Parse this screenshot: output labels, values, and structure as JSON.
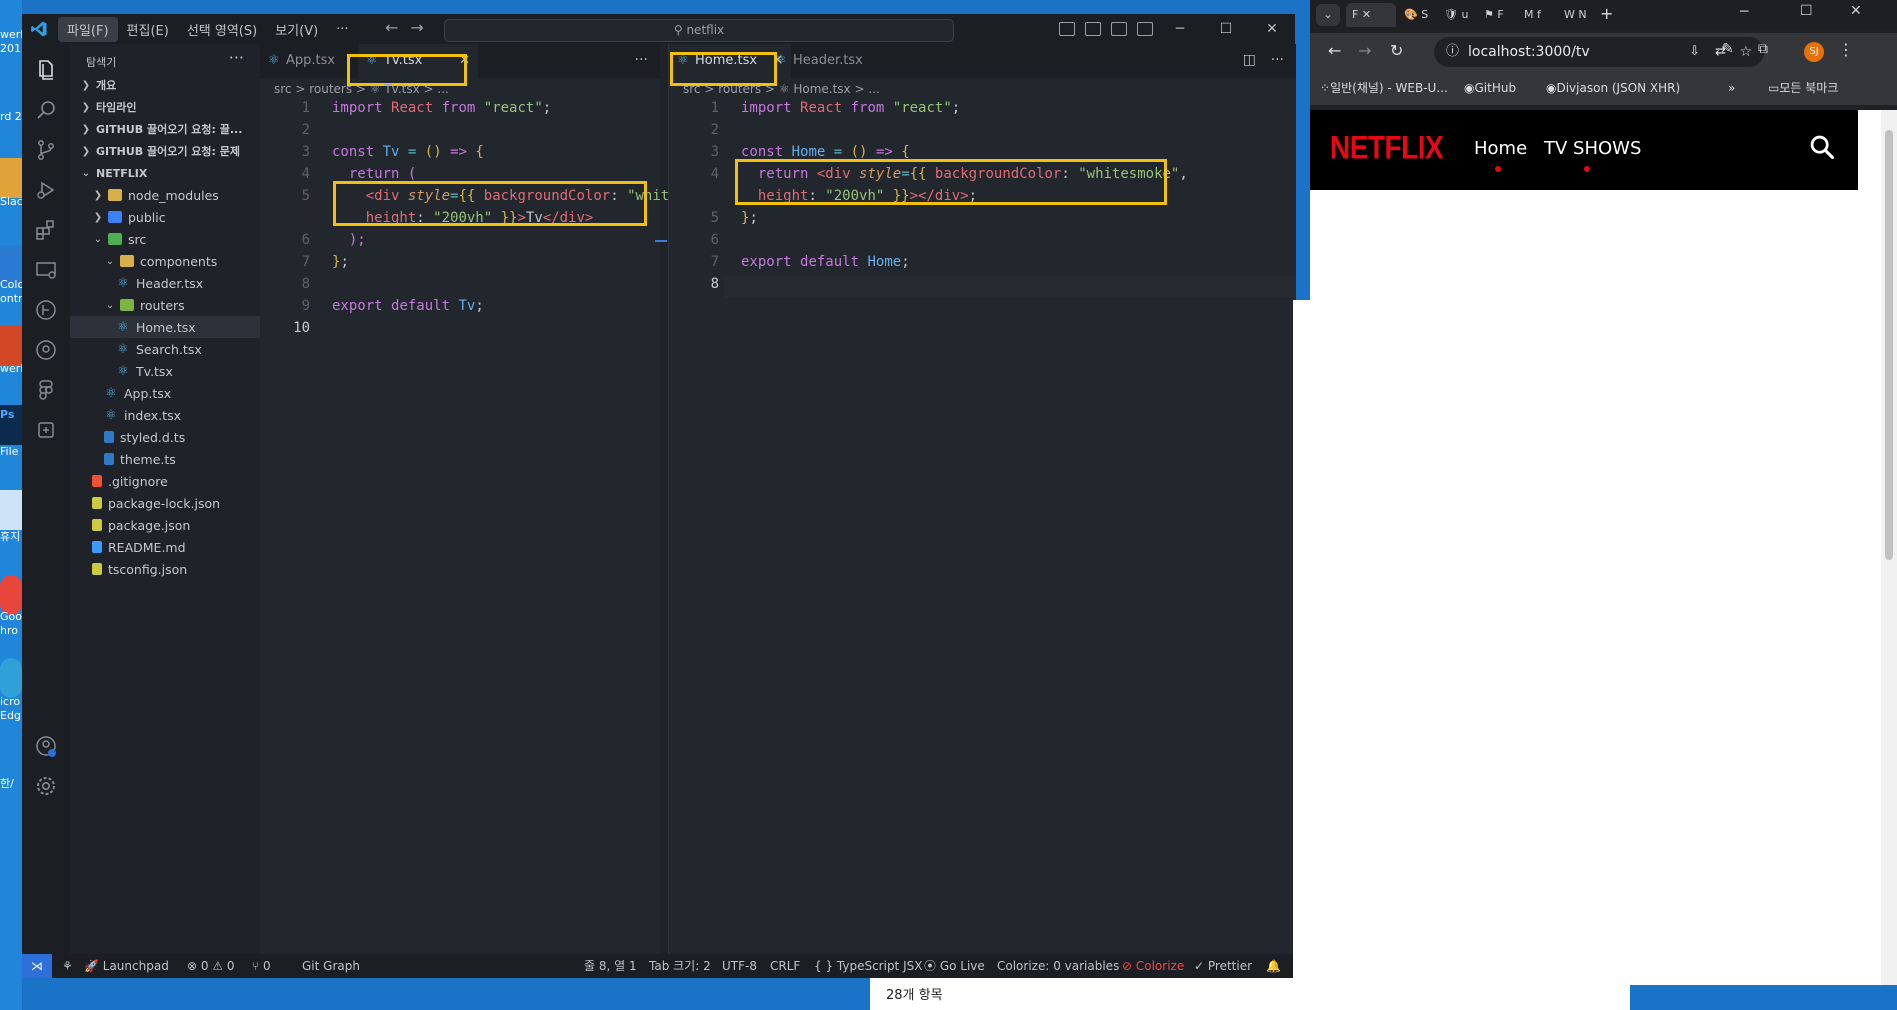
{
  "desktop": {
    "labels": [
      "werF",
      "201",
      "rd 2",
      "Slac",
      "Colo",
      "ontr",
      "werF",
      "Ps",
      "File",
      "휴지",
      "Goo",
      "hro",
      "icro",
      "Edg",
      "한/"
    ]
  },
  "vscode": {
    "menu": [
      "파일(F)",
      "편집(E)",
      "선택 영역(S)",
      "보기(V)",
      "···"
    ],
    "search_text": "netflix",
    "explorer_title": "탐색기",
    "sections": [
      "개요",
      "타임라인",
      "GITHUB 끌어오기 요청: 끌...",
      "GITHUB 끌어오기 요청: 문제",
      "NETFLIX"
    ],
    "tree": [
      {
        "label": "node_modules",
        "depth": 1,
        "type": "folder",
        "open": false
      },
      {
        "label": "public",
        "depth": 1,
        "type": "folder",
        "open": false
      },
      {
        "label": "src",
        "depth": 1,
        "type": "folder",
        "open": true
      },
      {
        "label": "components",
        "depth": 2,
        "type": "folder",
        "open": true
      },
      {
        "label": "Header.tsx",
        "depth": 3,
        "type": "react"
      },
      {
        "label": "routers",
        "depth": 2,
        "type": "folder",
        "open": true
      },
      {
        "label": "Home.tsx",
        "depth": 3,
        "type": "react",
        "selected": true
      },
      {
        "label": "Search.tsx",
        "depth": 3,
        "type": "react"
      },
      {
        "label": "Tv.tsx",
        "depth": 3,
        "type": "react"
      },
      {
        "label": "App.tsx",
        "depth": 2,
        "type": "react"
      },
      {
        "label": "index.tsx",
        "depth": 2,
        "type": "react"
      },
      {
        "label": "styled.d.ts",
        "depth": 2,
        "type": "ts"
      },
      {
        "label": "theme.ts",
        "depth": 2,
        "type": "ts"
      },
      {
        "label": ".gitignore",
        "depth": 1,
        "type": "git"
      },
      {
        "label": "package-lock.json",
        "depth": 1,
        "type": "json"
      },
      {
        "label": "package.json",
        "depth": 1,
        "type": "json"
      },
      {
        "label": "README.md",
        "depth": 1,
        "type": "info"
      },
      {
        "label": "tsconfig.json",
        "depth": 1,
        "type": "json"
      }
    ],
    "left_editor": {
      "tabs": [
        "App.tsx",
        "Tv.tsx"
      ],
      "active_tab": "Tv.tsx",
      "breadcrumb": "src > routers > ⚛ Tv.tsx > ...",
      "line_numbers": [
        "1",
        "2",
        "3",
        "4",
        "5",
        "",
        "6",
        "7",
        "8",
        "9",
        "10"
      ]
    },
    "right_editor": {
      "tabs": [
        "Home.tsx",
        "Header.tsx"
      ],
      "active_tab": "Home.tsx",
      "breadcrumb": "src > routers > ⚛ Home.tsx > ...",
      "line_numbers": [
        "1",
        "2",
        "3",
        "4",
        "",
        "5",
        "6",
        "7",
        "8"
      ]
    },
    "status": {
      "launchpad": "Launchpad",
      "problems": "⊗ 0 ⚠ 0",
      "ports": "⑂ 0",
      "git_graph": "Git Graph",
      "position": "줄 8, 열 1",
      "tab_size": "Tab 크기: 2",
      "encoding": "UTF-8",
      "eol": "CRLF",
      "language": "{ } TypeScript JSX",
      "golive": "Go Live",
      "colorize_vars": "Colorize: 0 variables",
      "colorize": "⊘ Colorize",
      "prettier": "✓ Prettier"
    }
  },
  "chrome": {
    "tab_labels": [
      "F",
      "S",
      "u",
      "F",
      "f",
      "N"
    ],
    "url": "localhost:3000/tv",
    "bookmarks": [
      "일반(채널) - WEB-U...",
      "GitHub",
      "Divjason (JSON XHR)",
      "»",
      "모든 북마크"
    ],
    "profile": "SJ",
    "netflix": {
      "logo": "NETFLIX",
      "nav": [
        "Home",
        "TV SHOWS"
      ]
    }
  },
  "explorer_status": "28개 항목",
  "colors": {
    "highlight": "#f2c00e",
    "netflix_red": "#e50914"
  }
}
